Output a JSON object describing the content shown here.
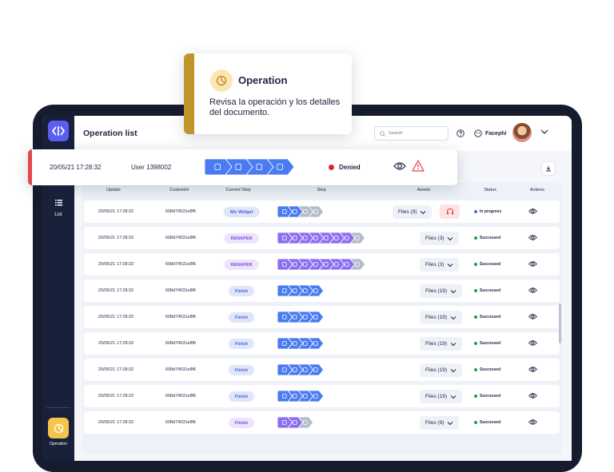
{
  "app": {
    "title": "Operation list"
  },
  "search": {
    "placeholder": "Search"
  },
  "org": {
    "name": "Facephi"
  },
  "sidebar": {
    "list_label": "List",
    "operation_label": "Operation"
  },
  "callout": {
    "title": "Operation",
    "description": "Revisa la operación y los detalles del documento."
  },
  "detail": {
    "datetime": "20/05/21 17:28:32",
    "user": "User 1398002",
    "status": "Denied",
    "status_color": "#e02424"
  },
  "table": {
    "columns": [
      "Update",
      "CustomId",
      "Current Step",
      "Step",
      "Assets",
      "Status",
      "Actions"
    ],
    "rows": [
      {
        "update": "20/05/21 17:28:32",
        "customid": "608d74531e8f6",
        "current_step": "Nfc Widget",
        "step_color": "blue",
        "files": "Files (9)",
        "status": "In progress",
        "status_color": "#3d6ef0",
        "steps": [
          "b",
          "b",
          "g",
          "g"
        ],
        "headset": true
      },
      {
        "update": "20/05/21 17:28:32",
        "customid": "608d74531e8f6",
        "current_step": "RENAPER",
        "step_color": "purple",
        "files": "Files (3)",
        "status": "Successed",
        "status_color": "#1fa33a",
        "steps": [
          "p",
          "p",
          "p",
          "p",
          "p",
          "p",
          "p",
          "g"
        ]
      },
      {
        "update": "20/05/21 17:28:32",
        "customid": "608d74531e8f6",
        "current_step": "RENAPER",
        "step_color": "purple",
        "files": "Files (3)",
        "status": "Successed",
        "status_color": "#1fa33a",
        "steps": [
          "p",
          "p",
          "p",
          "p",
          "p",
          "p",
          "p",
          "g"
        ]
      },
      {
        "update": "20/05/21 17:28:32",
        "customid": "608d74531e8f6",
        "current_step": "Finish",
        "step_color": "blue",
        "files": "Files (19)",
        "status": "Successed",
        "status_color": "#1fa33a",
        "steps": [
          "b",
          "b",
          "b",
          "b"
        ]
      },
      {
        "update": "20/05/21 17:28:32",
        "customid": "608d74531e8f6",
        "current_step": "Finish",
        "step_color": "blue",
        "files": "Files (19)",
        "status": "Successed",
        "status_color": "#1fa33a",
        "steps": [
          "b",
          "b",
          "b",
          "b"
        ]
      },
      {
        "update": "20/05/21 17:28:32",
        "customid": "608d74531e8f6",
        "current_step": "Finish",
        "step_color": "blue",
        "files": "Files (19)",
        "status": "Successed",
        "status_color": "#1fa33a",
        "steps": [
          "b",
          "b",
          "b",
          "b"
        ]
      },
      {
        "update": "20/05/21 17:28:32",
        "customid": "608d74531e8f6",
        "current_step": "Finish",
        "step_color": "blue",
        "files": "Files (19)",
        "status": "Successed",
        "status_color": "#1fa33a",
        "steps": [
          "b",
          "b",
          "b",
          "b"
        ]
      },
      {
        "update": "20/05/21 17:28:32",
        "customid": "608d74531e8f6",
        "current_step": "Finish",
        "step_color": "blue",
        "files": "Files (19)",
        "status": "Successed",
        "status_color": "#1fa33a",
        "steps": [
          "b",
          "b",
          "b",
          "b"
        ]
      },
      {
        "update": "20/05/21 17:28:32",
        "customid": "608d74531e8f6",
        "current_step": "Finish",
        "step_color": "purple",
        "files": "Files (9)",
        "status": "Successed",
        "status_color": "#1fa33a",
        "steps": [
          "p",
          "p",
          "g"
        ]
      }
    ]
  },
  "colors": {
    "accent": "#5b5ef0",
    "sidebar": "#19203a",
    "step_blue": "#4a7bf2",
    "step_purple": "#8c6ef0",
    "step_gray": "#b5bccb"
  }
}
